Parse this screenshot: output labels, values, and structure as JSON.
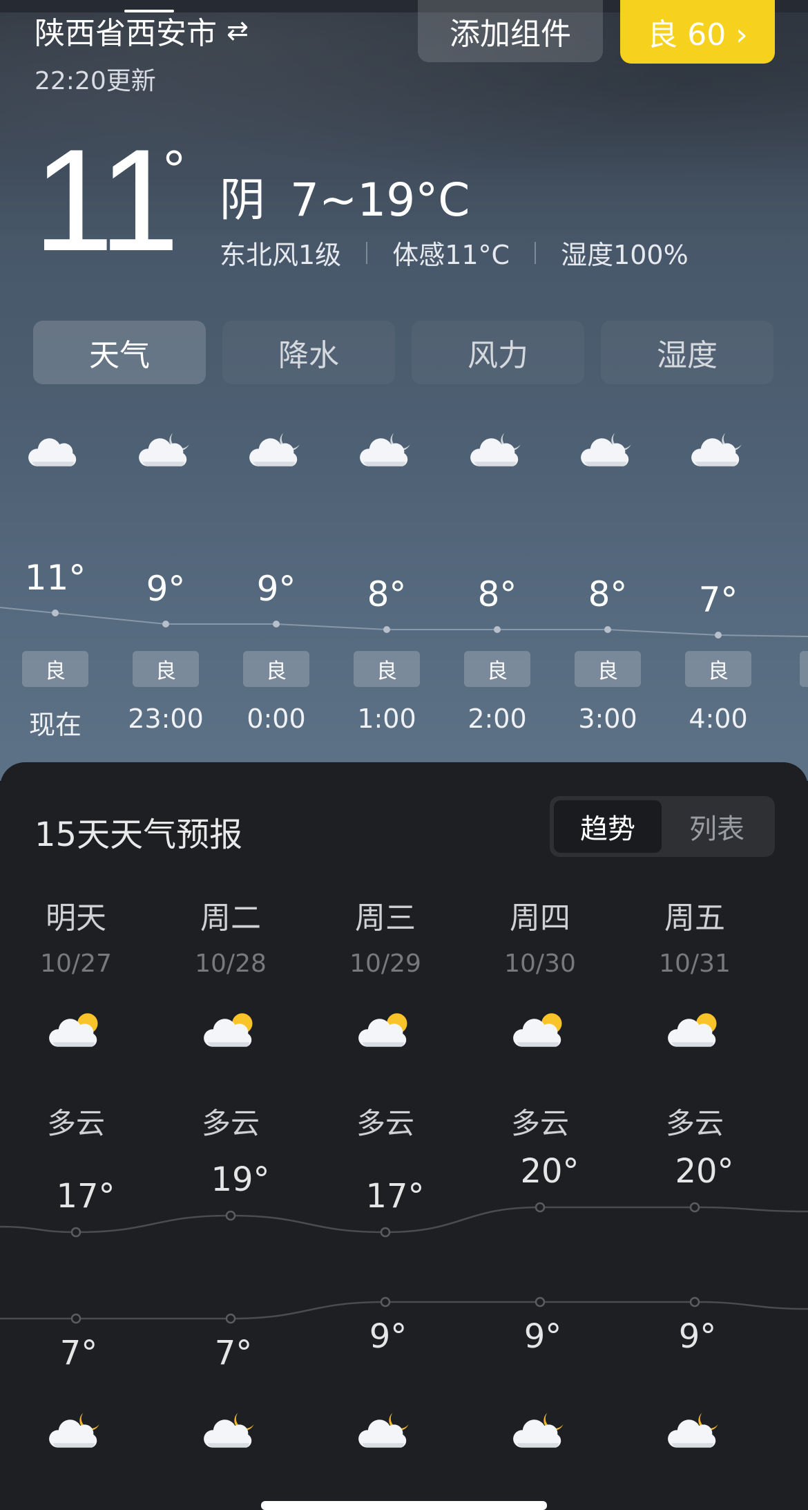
{
  "header": {
    "location": "陕西省西安市",
    "swap_icon": "⇄",
    "updated": "22:20更新",
    "widget_button": "添加组件",
    "aqi_button": "良 60 ›"
  },
  "current": {
    "temp": "11",
    "deg": "°",
    "condition": "阴",
    "range": "7~19°C",
    "wind": "东北风1级",
    "feels": "体感11°C",
    "humidity": "湿度100%"
  },
  "tabs": [
    "天气",
    "降水",
    "风力",
    "湿度"
  ],
  "hourly": [
    {
      "temp": "11°",
      "aqi": "良",
      "time": "现在",
      "icon": "cloud-icon"
    },
    {
      "temp": "9°",
      "aqi": "良",
      "time": "23:00",
      "icon": "cloud-moon-icon"
    },
    {
      "temp": "9°",
      "aqi": "良",
      "time": "0:00",
      "icon": "cloud-moon-icon"
    },
    {
      "temp": "8°",
      "aqi": "良",
      "time": "1:00",
      "icon": "cloud-moon-icon"
    },
    {
      "temp": "8°",
      "aqi": "良",
      "time": "2:00",
      "icon": "cloud-moon-icon"
    },
    {
      "temp": "8°",
      "aqi": "良",
      "time": "3:00",
      "icon": "cloud-moon-icon"
    },
    {
      "temp": "7°",
      "aqi": "良",
      "time": "4:00",
      "icon": "cloud-moon-icon"
    }
  ],
  "forecast": {
    "title": "15天天气预报",
    "toggle": [
      "趋势",
      "列表"
    ],
    "days": [
      {
        "day": "明天",
        "date": "10/27",
        "cond": "多云",
        "high": "17°",
        "low": "7°"
      },
      {
        "day": "周二",
        "date": "10/28",
        "cond": "多云",
        "high": "19°",
        "low": "7°"
      },
      {
        "day": "周三",
        "date": "10/29",
        "cond": "多云",
        "high": "17°",
        "low": "9°"
      },
      {
        "day": "周四",
        "date": "10/30",
        "cond": "多云",
        "high": "20°",
        "low": "9°"
      },
      {
        "day": "周五",
        "date": "10/31",
        "cond": "多云",
        "high": "20°",
        "low": "9°"
      }
    ]
  },
  "colors": {
    "aqi_yellow": "#f6d21f",
    "sun": "#f9c32a",
    "panel": "#1e1f22"
  }
}
